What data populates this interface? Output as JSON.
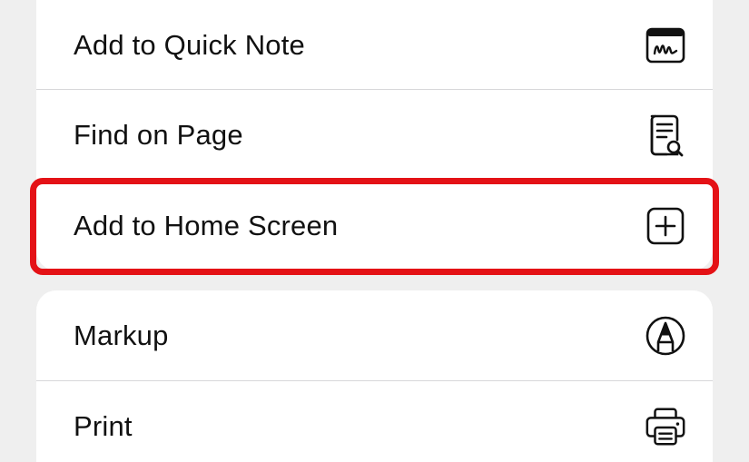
{
  "menu": {
    "group1": [
      {
        "label": "Add to Quick Note",
        "icon": "quick-note-icon"
      },
      {
        "label": "Find on Page",
        "icon": "find-on-page-icon"
      },
      {
        "label": "Add to Home Screen",
        "icon": "add-square-icon"
      }
    ],
    "group2": [
      {
        "label": "Markup",
        "icon": "markup-icon"
      },
      {
        "label": "Print",
        "icon": "printer-icon"
      }
    ]
  },
  "highlight": {
    "target": "Add to Home Screen",
    "color": "#e41216"
  },
  "colors": {
    "background": "#efefef",
    "card": "#ffffff",
    "text": "#111111",
    "separator": "#d7d7d9"
  }
}
